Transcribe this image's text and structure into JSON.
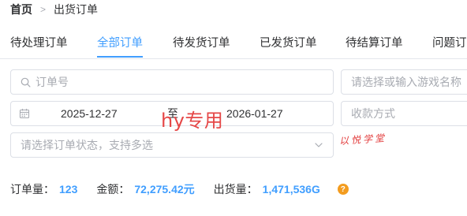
{
  "breadcrumb": {
    "home": "首页",
    "separator": ">",
    "current": "出货订单"
  },
  "tabs": [
    {
      "label": "待处理订单",
      "active": false
    },
    {
      "label": "全部订单",
      "active": true
    },
    {
      "label": "待发货订单",
      "active": false
    },
    {
      "label": "已发货订单",
      "active": false
    },
    {
      "label": "待结算订单",
      "active": false
    },
    {
      "label": "问题订单",
      "active": false
    }
  ],
  "filters": {
    "order_no_placeholder": "订单号",
    "game_placeholder": "请选择或输入游戏名称",
    "date_start": "2025-12-27",
    "date_separator": "至",
    "date_end": "2026-01-27",
    "payment_placeholder": "收款方式",
    "status_placeholder": "请选择订单状态，支持多选"
  },
  "overlay": {
    "watermark": "hy专用",
    "signature": "以悦学堂"
  },
  "stats": {
    "order_count_label": "订单量：",
    "order_count": "123",
    "amount_label": "金额：",
    "amount": "72,275.42元",
    "shipped_label": "出货量：",
    "shipped": "1,471,536G",
    "help": "?"
  },
  "colors": {
    "accent": "#409eff",
    "help_badge": "#f39c1f",
    "watermark": "#e54747"
  },
  "icons": [
    "search-icon",
    "calendar-icon",
    "chevron-down-icon",
    "help-icon"
  ]
}
